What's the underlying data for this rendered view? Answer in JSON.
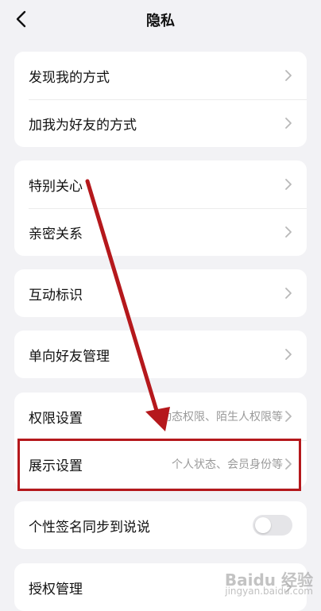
{
  "header": {
    "title": "隐私"
  },
  "groups": [
    {
      "items": [
        {
          "label": "发现我的方式"
        },
        {
          "label": "加我为好友的方式"
        }
      ]
    },
    {
      "items": [
        {
          "label": "特别关心"
        },
        {
          "label": "亲密关系"
        }
      ]
    },
    {
      "items": [
        {
          "label": "互动标识"
        }
      ]
    },
    {
      "items": [
        {
          "label": "单向好友管理"
        }
      ]
    },
    {
      "items": [
        {
          "label": "权限设置",
          "sub": "动态权限、陌生人权限等"
        },
        {
          "label": "展示设置",
          "sub": "个人状态、会员身份等"
        }
      ]
    },
    {
      "items": [
        {
          "label": "个性签名同步到说说",
          "toggle_on": false
        }
      ]
    },
    {
      "items": [
        {
          "label": "授权管理"
        }
      ]
    }
  ],
  "annotation": {
    "color": "#b5181c"
  },
  "watermark": {
    "brand": "Baidu 经验",
    "url": "jingyan.baidu.com"
  }
}
